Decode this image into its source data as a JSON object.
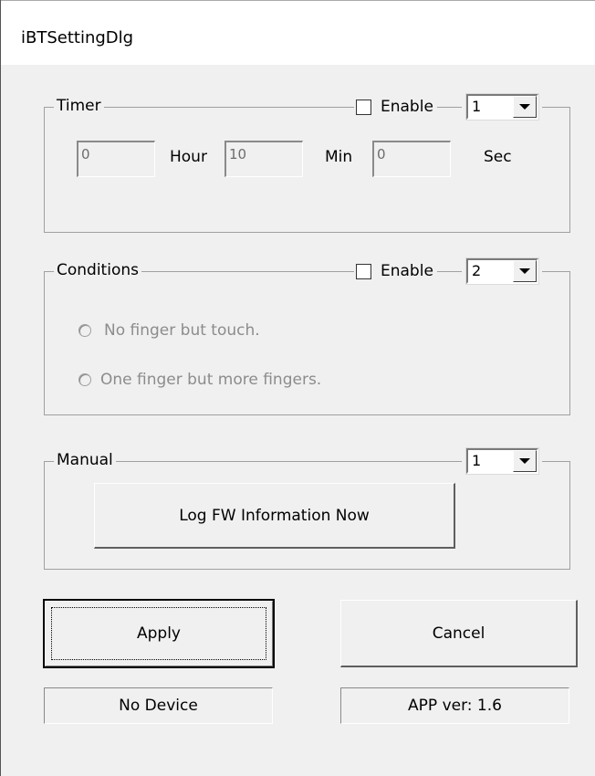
{
  "window": {
    "title": "iBTSettingDlg"
  },
  "timer": {
    "legend": "Timer",
    "enable_label": "Enable",
    "enabled": false,
    "combo_value": "1",
    "hour_value": "0",
    "hour_label": "Hour",
    "min_value": "10",
    "min_label": "Min",
    "sec_value": "0",
    "sec_label": "Sec"
  },
  "conditions": {
    "legend": "Conditions",
    "enable_label": "Enable",
    "enabled": false,
    "combo_value": "2",
    "options": [
      {
        "label": "No finger but touch.",
        "selected": false
      },
      {
        "label": "One finger  but more fingers.",
        "selected": false
      }
    ]
  },
  "manual": {
    "legend": "Manual",
    "combo_value": "1",
    "log_button_label": "Log FW Information Now"
  },
  "buttons": {
    "apply_label": "Apply",
    "cancel_label": "Cancel"
  },
  "status": {
    "device_text": "No Device",
    "version_text": "APP ver: 1.6"
  }
}
